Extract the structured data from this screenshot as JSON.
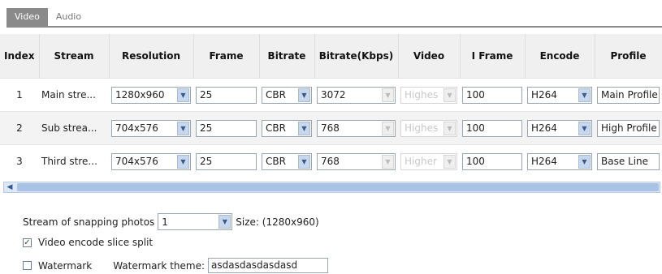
{
  "tabs": {
    "video": "Video",
    "audio": "Audio"
  },
  "table": {
    "headers": {
      "index": "Index",
      "stream": "Stream",
      "resolution": "Resolution",
      "frame": "Frame",
      "bitrate": "Bitrate",
      "bitrate_kbps": "Bitrate(Kbps)",
      "video": "Video",
      "iframe": "I Frame",
      "encode": "Encode",
      "profile": "Profile"
    },
    "rows": [
      {
        "index": "1",
        "stream": "Main stre...",
        "resolution": "1280x960",
        "frame": "25",
        "bitrate": "CBR",
        "bitrate_kbps": "3072",
        "video": "Highes",
        "iframe": "100",
        "encode": "H264",
        "profile": "Main Profile"
      },
      {
        "index": "2",
        "stream": "Sub strea...",
        "resolution": "704x576",
        "frame": "25",
        "bitrate": "CBR",
        "bitrate_kbps": "768",
        "video": "Highes",
        "iframe": "100",
        "encode": "H264",
        "profile": "High Profile"
      },
      {
        "index": "3",
        "stream": "Third stre...",
        "resolution": "704x576",
        "frame": "25",
        "bitrate": "CBR",
        "bitrate_kbps": "768",
        "video": "Higher",
        "iframe": "100",
        "encode": "H264",
        "profile": "Base Line"
      }
    ]
  },
  "snapping": {
    "label": "Stream of snapping photos",
    "value": "1",
    "size_text": "Size: (1280x960)"
  },
  "slice_split": {
    "label": "Video encode slice split",
    "checked": true
  },
  "watermark": {
    "label": "Watermark",
    "theme_label": "Watermark theme:",
    "theme_value": "asdasdasdasdasd",
    "checked": false
  }
}
